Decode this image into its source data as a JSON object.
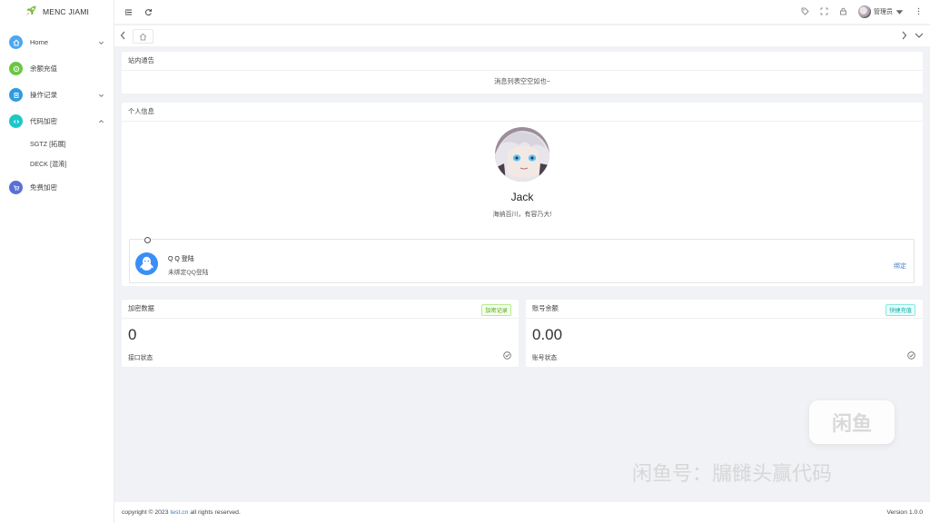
{
  "brand": {
    "name": "MENC JIAMI"
  },
  "sidebar": {
    "items": [
      {
        "label": "Home",
        "icon": "home-icon",
        "color": "#4aa8f0"
      },
      {
        "label": "余额充值",
        "icon": "recharge-icon",
        "color": "#6cc644"
      },
      {
        "label": "操作记录",
        "icon": "record-icon",
        "color": "#2f9be0"
      },
      {
        "label": "代码加密",
        "icon": "code-icon",
        "color": "#1ec7c7"
      },
      {
        "label": "免费加密",
        "icon": "cart-icon",
        "color": "#5a6fd6"
      }
    ],
    "submenu": [
      "SGTZ [拓展]",
      "DECK [混淆]"
    ]
  },
  "header": {
    "user_name": "管理员"
  },
  "notice": {
    "title": "站内通告",
    "empty_text": "消息列表空空如也~"
  },
  "profile": {
    "section_title": "个人信息",
    "name": "Jack",
    "motto": "海纳百川，有容乃大!",
    "qq": {
      "title": "Q Q 登陆",
      "status": "未绑定QQ登陆",
      "bind_label": "绑定"
    }
  },
  "stats": {
    "encrypt": {
      "title": "加密数据",
      "badge": "加密记录",
      "value": "0",
      "label": "接口状态",
      "badge_color": "#f6ffed"
    },
    "balance": {
      "title": "账号余额",
      "badge": "快捷充值",
      "value": "0.00",
      "label": "账号状态",
      "badge_color": "#e6fffb"
    }
  },
  "footer": {
    "copyright_pre": "copyright © 2023",
    "link": "test.cn",
    "copyright_post": "all rights reserved.",
    "version": "Version 1.0.0"
  },
  "watermark": {
    "logo": "闲鱼",
    "text": "闲鱼号：牖雠头赢代码"
  }
}
